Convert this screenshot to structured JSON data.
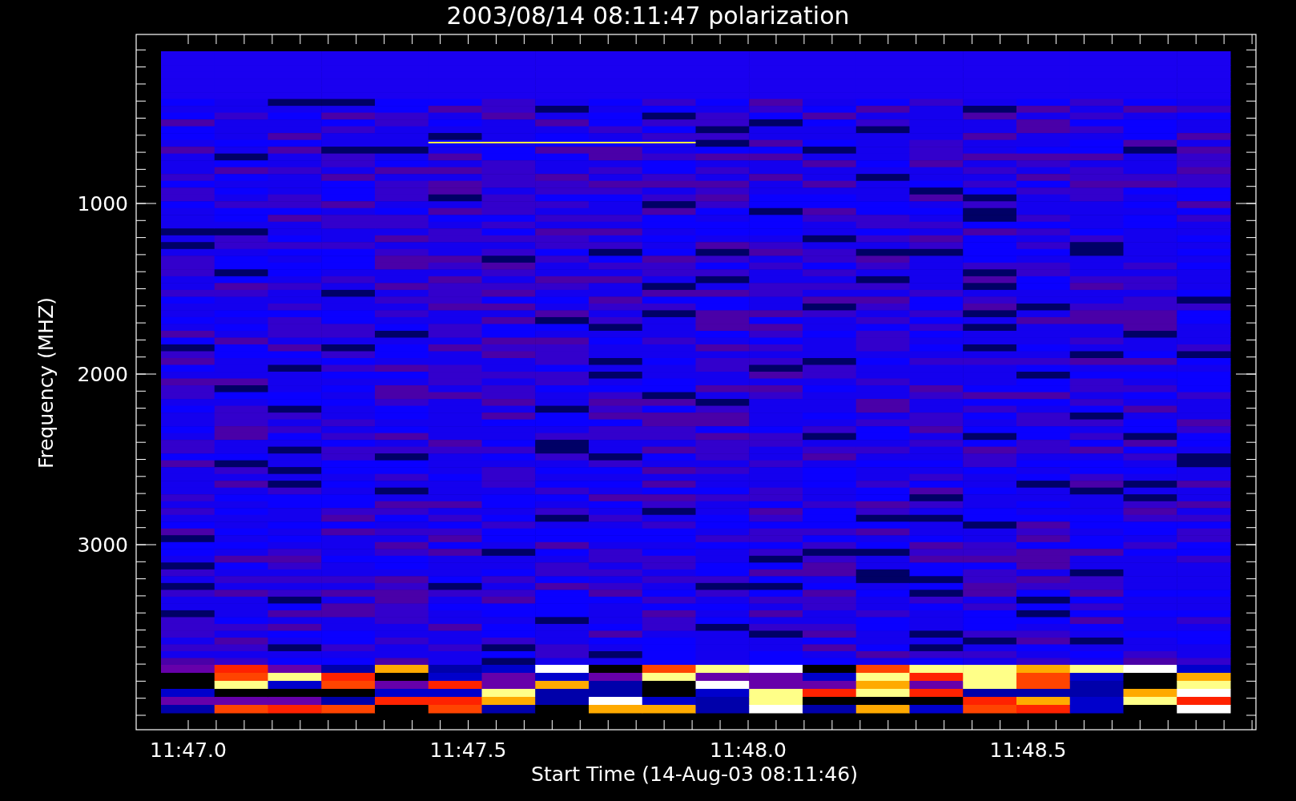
{
  "title": "2003/08/14 08:11:47 polarization",
  "y_axis": {
    "label": "Frequency (MHZ)",
    "ticks": [
      "1000",
      "2000",
      "3000"
    ]
  },
  "x_axis": {
    "label": "Start Time (14-Aug-03 08:11:46)",
    "ticks": [
      "11:47.0",
      "11:47.5",
      "11:48.0",
      "11:48.5"
    ]
  }
}
